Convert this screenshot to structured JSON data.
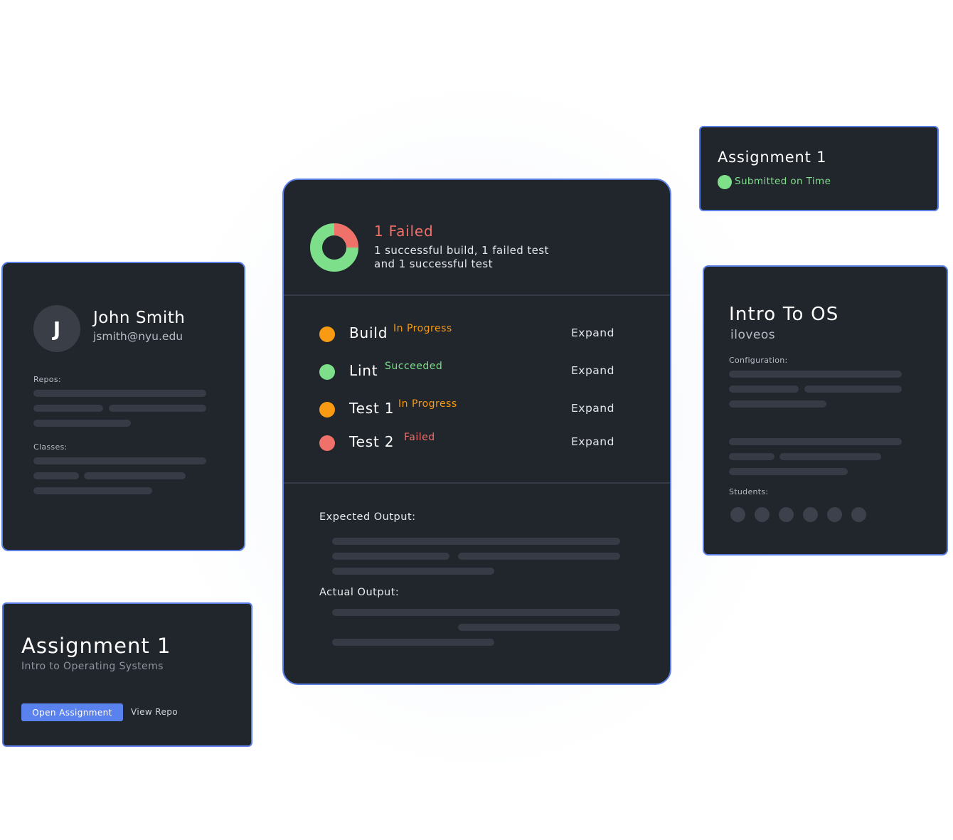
{
  "profile": {
    "avatar_initial": "J",
    "name": "John Smith",
    "email": "jsmith@nyu.edu",
    "repos_label": "Repos:",
    "classes_label": "Classes:"
  },
  "assignment_card": {
    "title": "Assignment 1",
    "subtitle": "Intro to Operating Systems",
    "open_button": "Open Assignment",
    "view_repo": "View Repo"
  },
  "build_summary": {
    "title": "1 Failed",
    "description": "1 successful build, 1 failed test and 1 successful test",
    "donut": {
      "failed_fraction": 0.25,
      "success_color": "#7ddf8a",
      "fail_color": "#f0706a"
    },
    "steps": [
      {
        "name": "Build",
        "status": "In Progress",
        "color": "#f89a12",
        "expand": "Expand"
      },
      {
        "name": "Lint",
        "status": "Succeeded",
        "color": "#7ddf8a",
        "expand": "Expand"
      },
      {
        "name": "Test 1",
        "status": "In Progress",
        "color": "#f89a12",
        "expand": "Expand"
      },
      {
        "name": "Test 2",
        "status": "Failed",
        "color": "#f0706a",
        "expand": "Expand"
      }
    ],
    "expected_output_label": "Expected Output:",
    "actual_output_label": "Actual Output:"
  },
  "status_card": {
    "title": "Assignment 1",
    "status": "Submitted on Time",
    "status_color": "#7fe08a"
  },
  "course_card": {
    "title": "Intro To OS",
    "code": "iloveos",
    "configuration_label": "Configuration:",
    "students_label": "Students:",
    "student_count": 6
  },
  "colors": {
    "card_bg": "#21252c",
    "card_border": "#5b7fe6",
    "accent": "#5a82ee"
  }
}
